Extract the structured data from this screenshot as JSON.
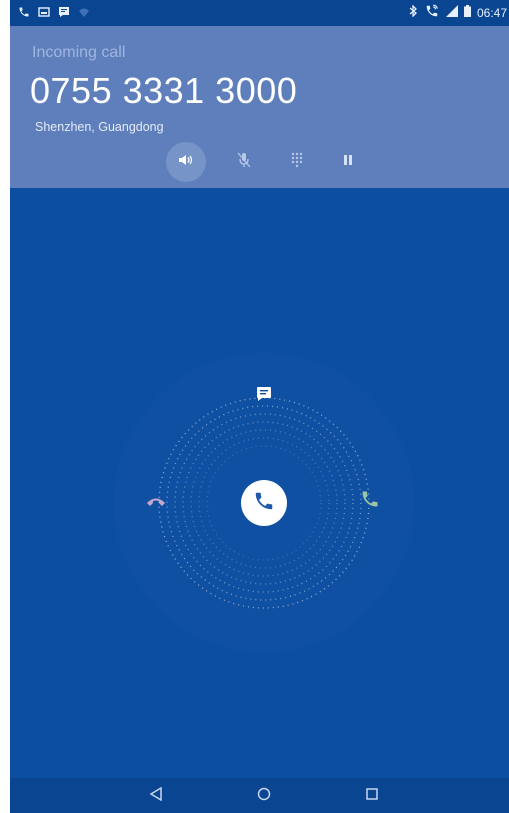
{
  "status_bar": {
    "time": "06:47",
    "left_icons": [
      "phone-icon",
      "screenshot-icon",
      "message-icon",
      "wifi-icon"
    ],
    "right_icons": [
      "bluetooth-icon",
      "call-active-icon",
      "signal-icon",
      "battery-icon"
    ]
  },
  "call": {
    "state_label": "Incoming call",
    "number": "0755 3331 3000",
    "location": "Shenzhen, Guangdong"
  },
  "controls": [
    {
      "name": "speaker",
      "icon": "speaker-icon",
      "active": true
    },
    {
      "name": "mute",
      "icon": "mute-mic-icon",
      "active": false
    },
    {
      "name": "dialpad",
      "icon": "dialpad-icon",
      "active": false
    },
    {
      "name": "hold",
      "icon": "pause-icon",
      "active": false
    }
  ],
  "glow_pad": {
    "center": "answer-icon",
    "top": "message-reply-icon",
    "left": "decline-call-icon",
    "right": "accept-call-icon"
  },
  "nav_bar": {
    "buttons": [
      "back-icon",
      "home-icon",
      "recents-icon"
    ]
  },
  "colors": {
    "background": "#0c4ea0",
    "header": "#5f7fbc",
    "status_bar": "#0a4592",
    "white": "#ffffff"
  }
}
